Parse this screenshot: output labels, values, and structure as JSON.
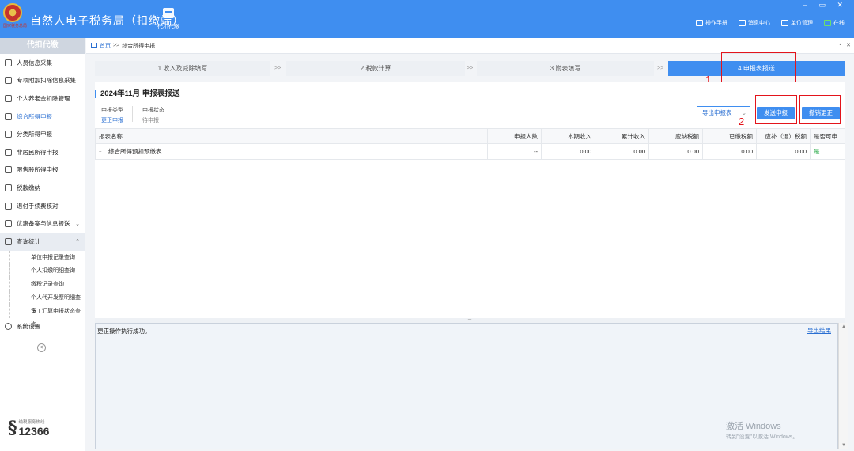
{
  "app": {
    "title": "自然人电子税务局（扣缴端）",
    "emblem_caption": "国家税务总局",
    "top_nav": "代扣代缴",
    "window_controls": "– ▭ ✕",
    "top_links": [
      {
        "label": "操作手册",
        "icon": "book-icon"
      },
      {
        "label": "消息中心",
        "icon": "mail-icon"
      },
      {
        "label": "单位管理",
        "icon": "building-icon"
      },
      {
        "label": "在线",
        "icon": "monitor-icon"
      }
    ]
  },
  "sidebar": {
    "header": "代扣代缴",
    "items": [
      {
        "label": "人员信息采集",
        "icon": "person-icon"
      },
      {
        "label": "专项附加扣除信息采集",
        "icon": "grid-icon"
      },
      {
        "label": "个人养老金扣除管理",
        "icon": "card-icon"
      },
      {
        "label": "综合所得申报",
        "icon": "layers-icon"
      },
      {
        "label": "分类所得申报",
        "icon": "clock-icon"
      },
      {
        "label": "非居民所得申报",
        "icon": "person-alt-icon"
      },
      {
        "label": "限售股所得申报",
        "icon": "chart-icon"
      },
      {
        "label": "税款缴纳",
        "icon": "folder-icon"
      },
      {
        "label": "退付手续费核对",
        "icon": "list-icon"
      },
      {
        "label": "优惠备案与信息报送",
        "icon": "doc-icon"
      },
      {
        "label": "查询统计",
        "icon": "search-icon"
      }
    ],
    "sub_items": [
      "单位申报记录查询",
      "个人扣缴明细查询",
      "缴税记录查询",
      "个人代开发票明细查询",
      "员工汇算申报状态查询"
    ],
    "settings": "系统设置",
    "collapse": "<",
    "hotline_label": "纳税服务热线",
    "hotline_number": "12366"
  },
  "breadcrumb": {
    "home": "首页",
    "sep": ">>",
    "current": "综合所得申报"
  },
  "steps": [
    "1 收入及减除填写",
    "2 税款计算",
    "3 附表填写",
    "4 申报表报送"
  ],
  "step_arrow": ">>",
  "report": {
    "title": "2024年11月 申报表报送",
    "type_label": "申报类型",
    "type_value": "更正申报",
    "status_label": "申报状态",
    "status_value": "待申报",
    "export_button": "导出申报表",
    "send_button": "发送申报",
    "cancel_button": "撤销更正",
    "columns": [
      "报表名称",
      "申报人数",
      "本期收入",
      "累计收入",
      "应纳税额",
      "已缴税额",
      "应补（退）税额",
      "是否可申..."
    ],
    "rows": [
      {
        "name": "综合所得预扣预缴表",
        "count": "--",
        "income": "0.00",
        "cum_income": "0.00",
        "tax_payable": "0.00",
        "tax_paid": "0.00",
        "tax_due": "0.00",
        "can_file": "是"
      }
    ]
  },
  "annotations": {
    "n1": "1",
    "n2": "2",
    "color": "#e3141b"
  },
  "log": {
    "message": "更正操作执行成功。",
    "export_link": "导出结果"
  },
  "watermark": {
    "line1": "激活 Windows",
    "line2": "转到\"设置\"以激活 Windows。"
  },
  "colors": {
    "primary": "#3f8ef0",
    "link": "#2a6fd2",
    "success": "#1aa33b"
  }
}
